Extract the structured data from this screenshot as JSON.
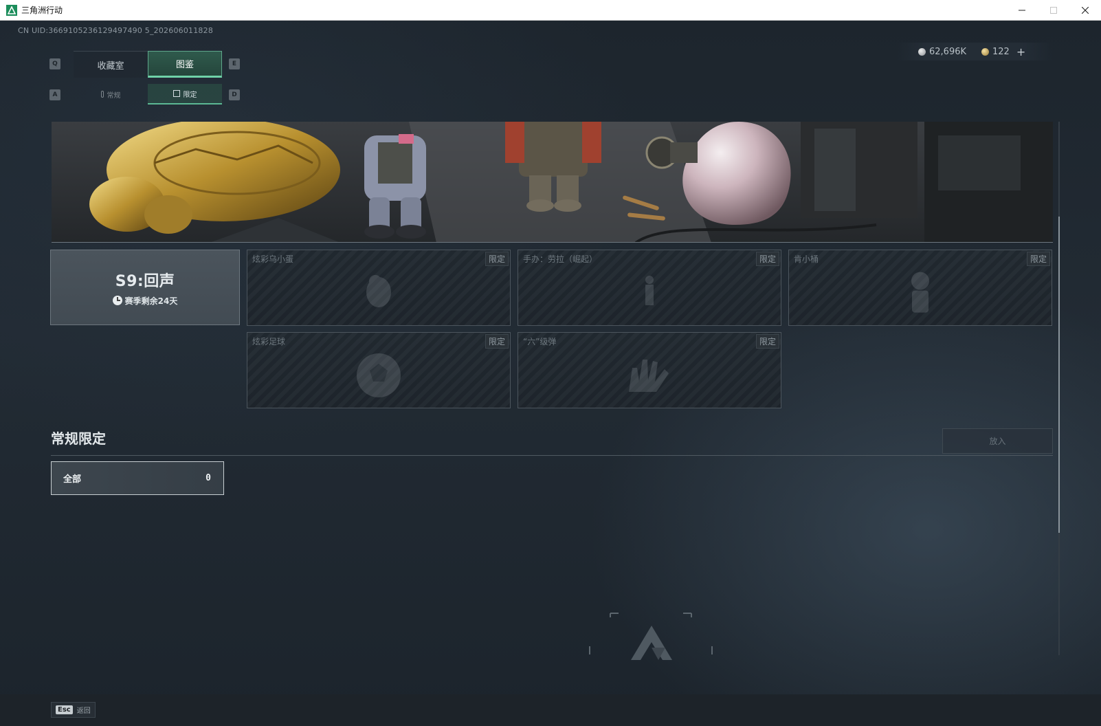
{
  "window": {
    "title": "三角洲行动",
    "controls": [
      "minimize-icon",
      "maximize-icon",
      "close-icon"
    ]
  },
  "uid": "CN UID:3669105236129497490 5_202606011828",
  "currency": {
    "silver": "62,696K",
    "gold": "122",
    "plus": "+"
  },
  "keys": {
    "prev_tab": "Q",
    "next_tab": "E",
    "prev_sub": "A",
    "next_sub": "D"
  },
  "tabs": [
    {
      "label": "收藏室",
      "active": false
    },
    {
      "label": "图鉴",
      "active": true
    }
  ],
  "sub_tabs": [
    {
      "label": "常规",
      "icon": "thermometer-icon",
      "active": false
    },
    {
      "label": "限定",
      "icon": "picture-icon",
      "active": true
    }
  ],
  "season": {
    "title": "S9:回声",
    "remaining": "赛季剩余24天"
  },
  "items": [
    {
      "name": "炫彩乌小蛋",
      "badge": "限定",
      "icon": "bird-silhouette-icon"
    },
    {
      "name": "手办：劳拉（崛起）",
      "badge": "限定",
      "icon": "figure-silhouette-icon"
    },
    {
      "name": "肯小桶",
      "badge": "限定",
      "icon": "mascot-silhouette-icon"
    },
    {
      "name": "炫彩足球",
      "badge": "限定",
      "icon": "soccer-ball-silhouette-icon"
    },
    {
      "name": "“六”级弹",
      "badge": "限定",
      "icon": "hand-silhouette-icon"
    }
  ],
  "section": {
    "title": "常规限定",
    "place_button": "放入"
  },
  "filter": {
    "label": "全部",
    "count": "0"
  },
  "footer": {
    "esc_key": "Esc",
    "esc_label": "返回"
  },
  "colors": {
    "accent": "#6fd2a8",
    "active_tab_bg": "#2f5a4c",
    "background": "#1b232b"
  }
}
